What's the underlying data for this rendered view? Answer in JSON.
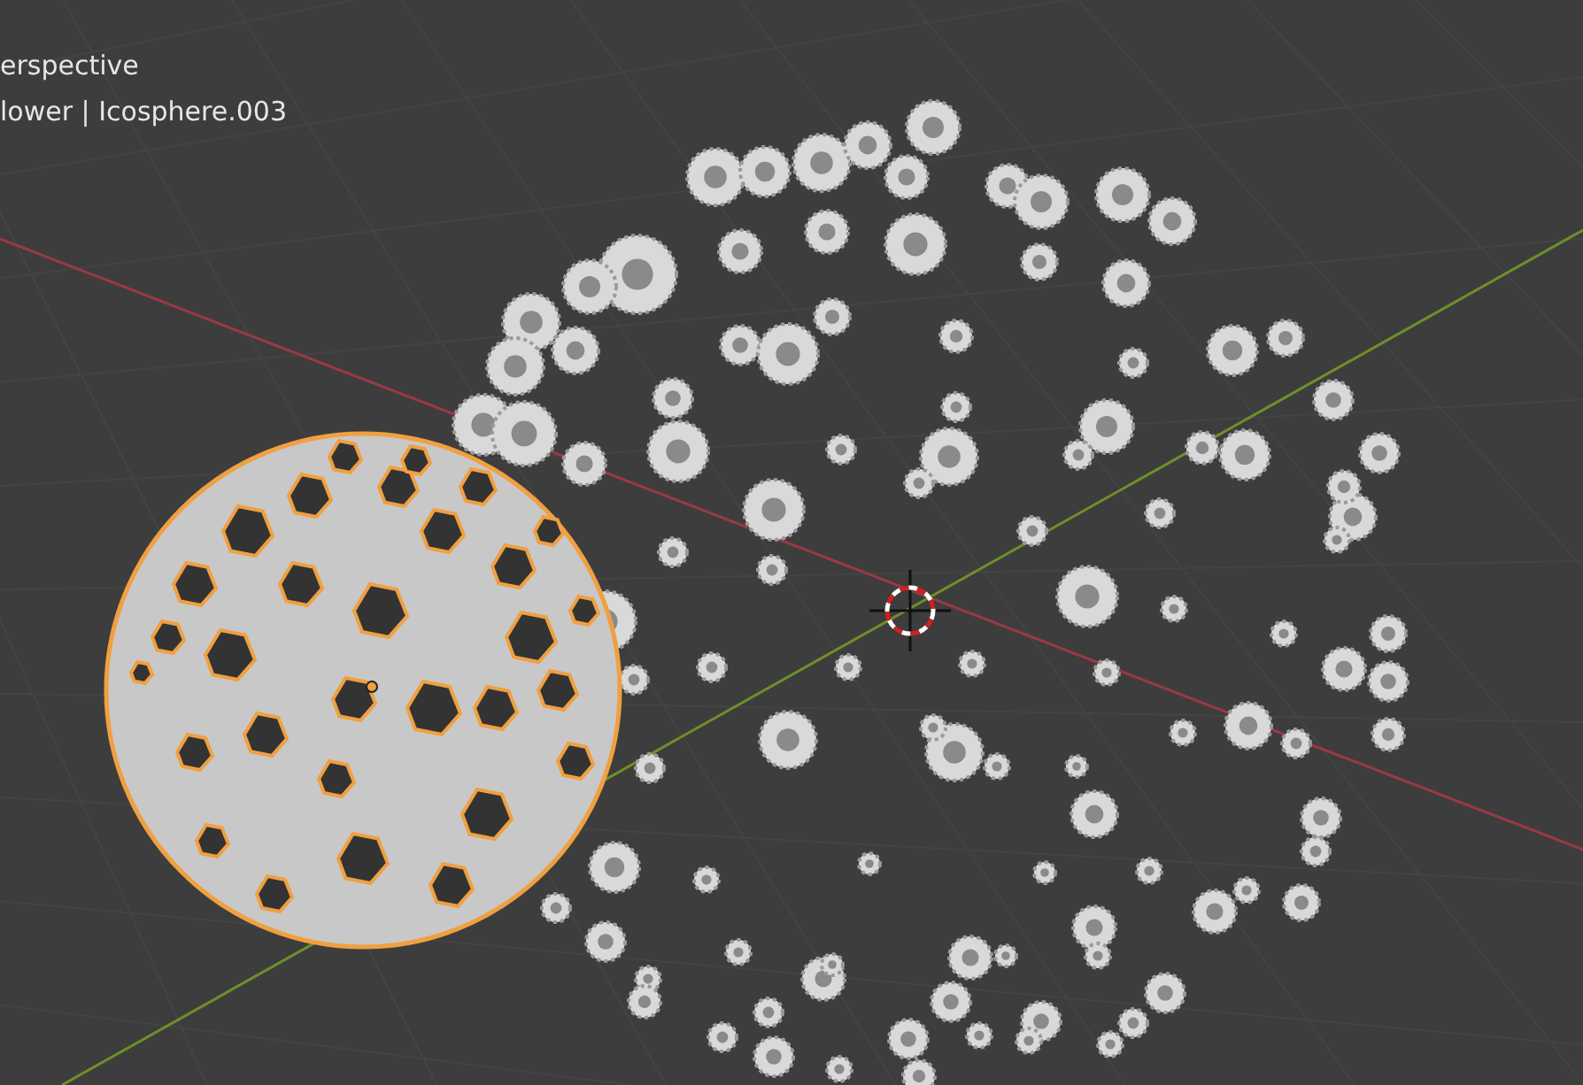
{
  "viewport": {
    "view_name": "erspective",
    "object_info": "lower | Icosphere.003"
  }
}
